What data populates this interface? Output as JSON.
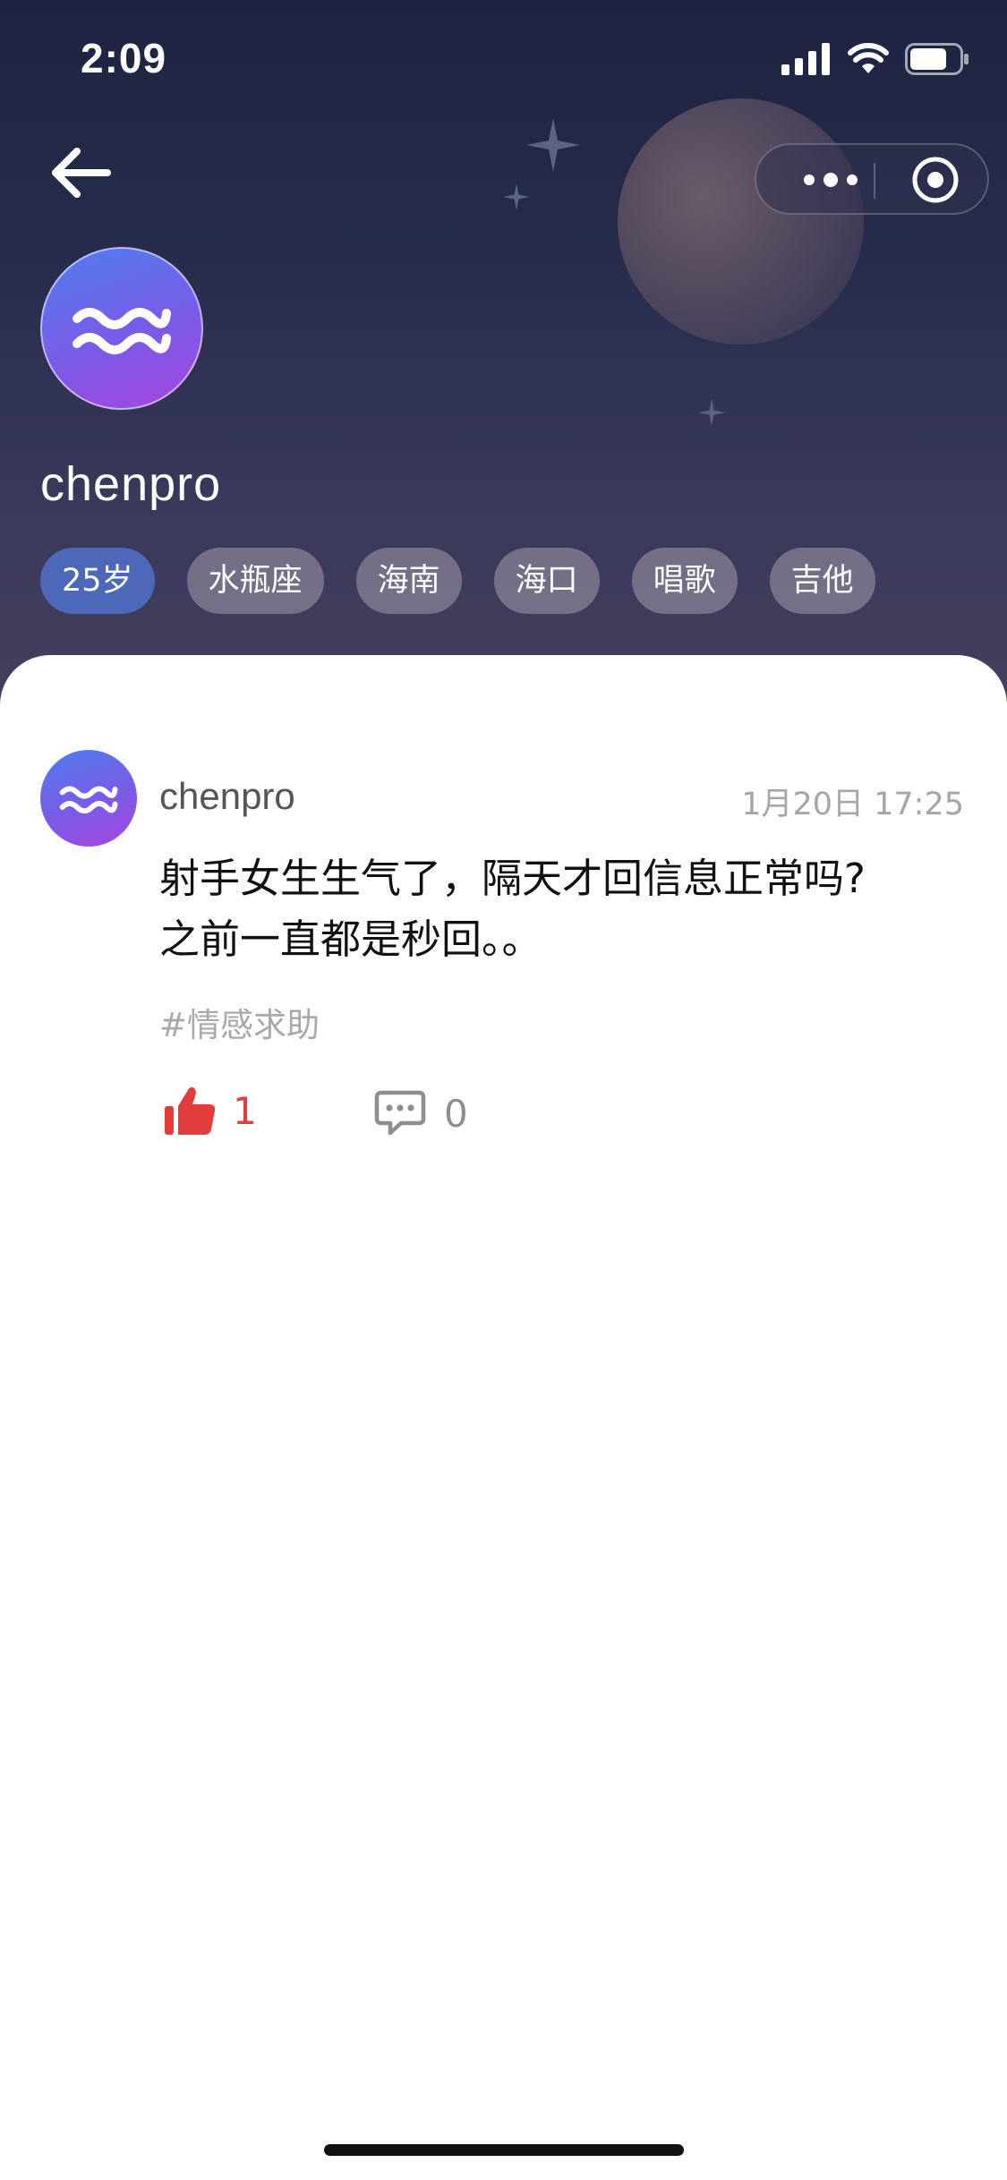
{
  "status_bar": {
    "time": "2:09",
    "icons": [
      "signal-icon",
      "wifi-icon",
      "battery-icon"
    ]
  },
  "nav": {
    "back_icon": "back-arrow-icon",
    "more_icon": "more-dots-icon",
    "target_icon": "target-circle-icon"
  },
  "profile": {
    "avatar_icon": "aquarius-wave-icon",
    "username": "chenpro",
    "tags": [
      "25岁",
      "水瓶座",
      "海南",
      "海口",
      "唱歌",
      "吉他"
    ]
  },
  "post": {
    "username": "chenpro",
    "time": "1月20日 17:25",
    "text_line1": "射手女生生气了，隔天才回信息正常吗?",
    "text_line2": "之前一直都是秒回。。",
    "topic": "#情感求助",
    "likes": "1",
    "comments": "0"
  },
  "colors": {
    "header_top": "#1d2340",
    "header_bottom": "#463f5e",
    "age_tag": "#4d68b8",
    "tag_bg": "#87829699",
    "like_red": "#e23c3c",
    "avatar_blue": "#4f7ef0",
    "avatar_purple": "#a744df"
  }
}
